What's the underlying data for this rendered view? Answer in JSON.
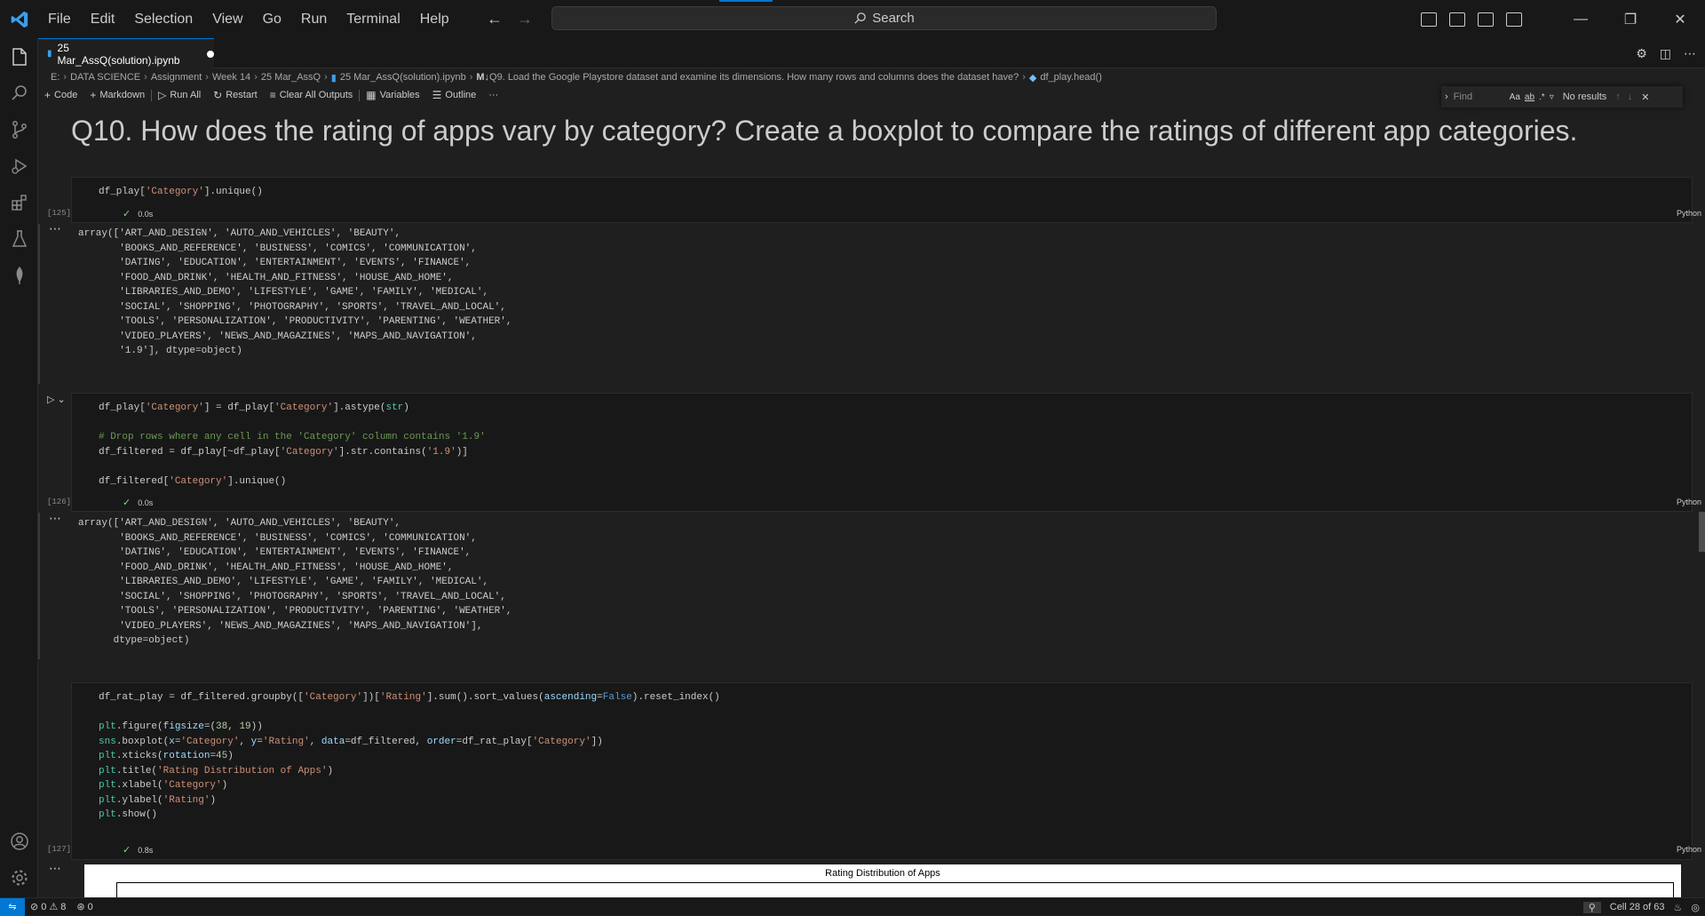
{
  "menu": [
    "File",
    "Edit",
    "Selection",
    "View",
    "Go",
    "Run",
    "Terminal",
    "Help"
  ],
  "search": {
    "label": "Search"
  },
  "tab": {
    "title": "25 Mar_AssQ(solution).ipynb"
  },
  "breadcrumb": {
    "items": [
      "E:",
      "DATA SCIENCE",
      "Assignment",
      "Week 14",
      "25 Mar_AssQ",
      "25 Mar_AssQ(solution).ipynb",
      "Q9. Load the Google Playstore dataset and examine its dimensions. How many rows and columns does the dataset have?",
      "df_play.head()"
    ],
    "md_prefix": "M↓"
  },
  "toolbar": {
    "code": "Code",
    "markdown": "Markdown",
    "run_all": "Run All",
    "restart": "Restart",
    "clear_outputs": "Clear All Outputs",
    "variables": "Variables",
    "outline": "Outline",
    "more": "···"
  },
  "find": {
    "placeholder": "Find",
    "case": "Aa",
    "word": "ab",
    "regex": ".*",
    "no_results": "No results"
  },
  "heading": "Q10. How does the rating of apps vary by category? Create a boxplot to compare the ratings of different app categories.",
  "cells": [
    {
      "count": "[125]",
      "time": "0.0s",
      "lang": "Python"
    },
    {
      "count": "[126]",
      "time": "0.0s",
      "lang": "Python"
    },
    {
      "count": "[127]",
      "time": "0.8s",
      "lang": "Python"
    }
  ],
  "outputs": [
    "array(['ART_AND_DESIGN', 'AUTO_AND_VEHICLES', 'BEAUTY',\n       'BOOKS_AND_REFERENCE', 'BUSINESS', 'COMICS', 'COMMUNICATION',\n       'DATING', 'EDUCATION', 'ENTERTAINMENT', 'EVENTS', 'FINANCE',\n       'FOOD_AND_DRINK', 'HEALTH_AND_FITNESS', 'HOUSE_AND_HOME',\n       'LIBRARIES_AND_DEMO', 'LIFESTYLE', 'GAME', 'FAMILY', 'MEDICAL',\n       'SOCIAL', 'SHOPPING', 'PHOTOGRAPHY', 'SPORTS', 'TRAVEL_AND_LOCAL',\n       'TOOLS', 'PERSONALIZATION', 'PRODUCTIVITY', 'PARENTING', 'WEATHER',\n       'VIDEO_PLAYERS', 'NEWS_AND_MAGAZINES', 'MAPS_AND_NAVIGATION',\n       '1.9'], dtype=object)",
    "array(['ART_AND_DESIGN', 'AUTO_AND_VEHICLES', 'BEAUTY',\n       'BOOKS_AND_REFERENCE', 'BUSINESS', 'COMICS', 'COMMUNICATION',\n       'DATING', 'EDUCATION', 'ENTERTAINMENT', 'EVENTS', 'FINANCE',\n       'FOOD_AND_DRINK', 'HEALTH_AND_FITNESS', 'HOUSE_AND_HOME',\n       'LIBRARIES_AND_DEMO', 'LIFESTYLE', 'GAME', 'FAMILY', 'MEDICAL',\n       'SOCIAL', 'SHOPPING', 'PHOTOGRAPHY', 'SPORTS', 'TRAVEL_AND_LOCAL',\n       'TOOLS', 'PERSONALIZATION', 'PRODUCTIVITY', 'PARENTING', 'WEATHER',\n       'VIDEO_PLAYERS', 'NEWS_AND_MAGAZINES', 'MAPS_AND_NAVIGATION'],\n      dtype=object)"
  ],
  "plot": {
    "title": "Rating Distribution of Apps"
  },
  "statusbar": {
    "errors": "0",
    "warnings": "8",
    "ports": "0",
    "cell_info": "Cell 28 of 63"
  },
  "colors": {
    "accent": "#0078d4",
    "background": "#1f1f1f",
    "cell_bg": "#181818",
    "success": "#89d185"
  }
}
